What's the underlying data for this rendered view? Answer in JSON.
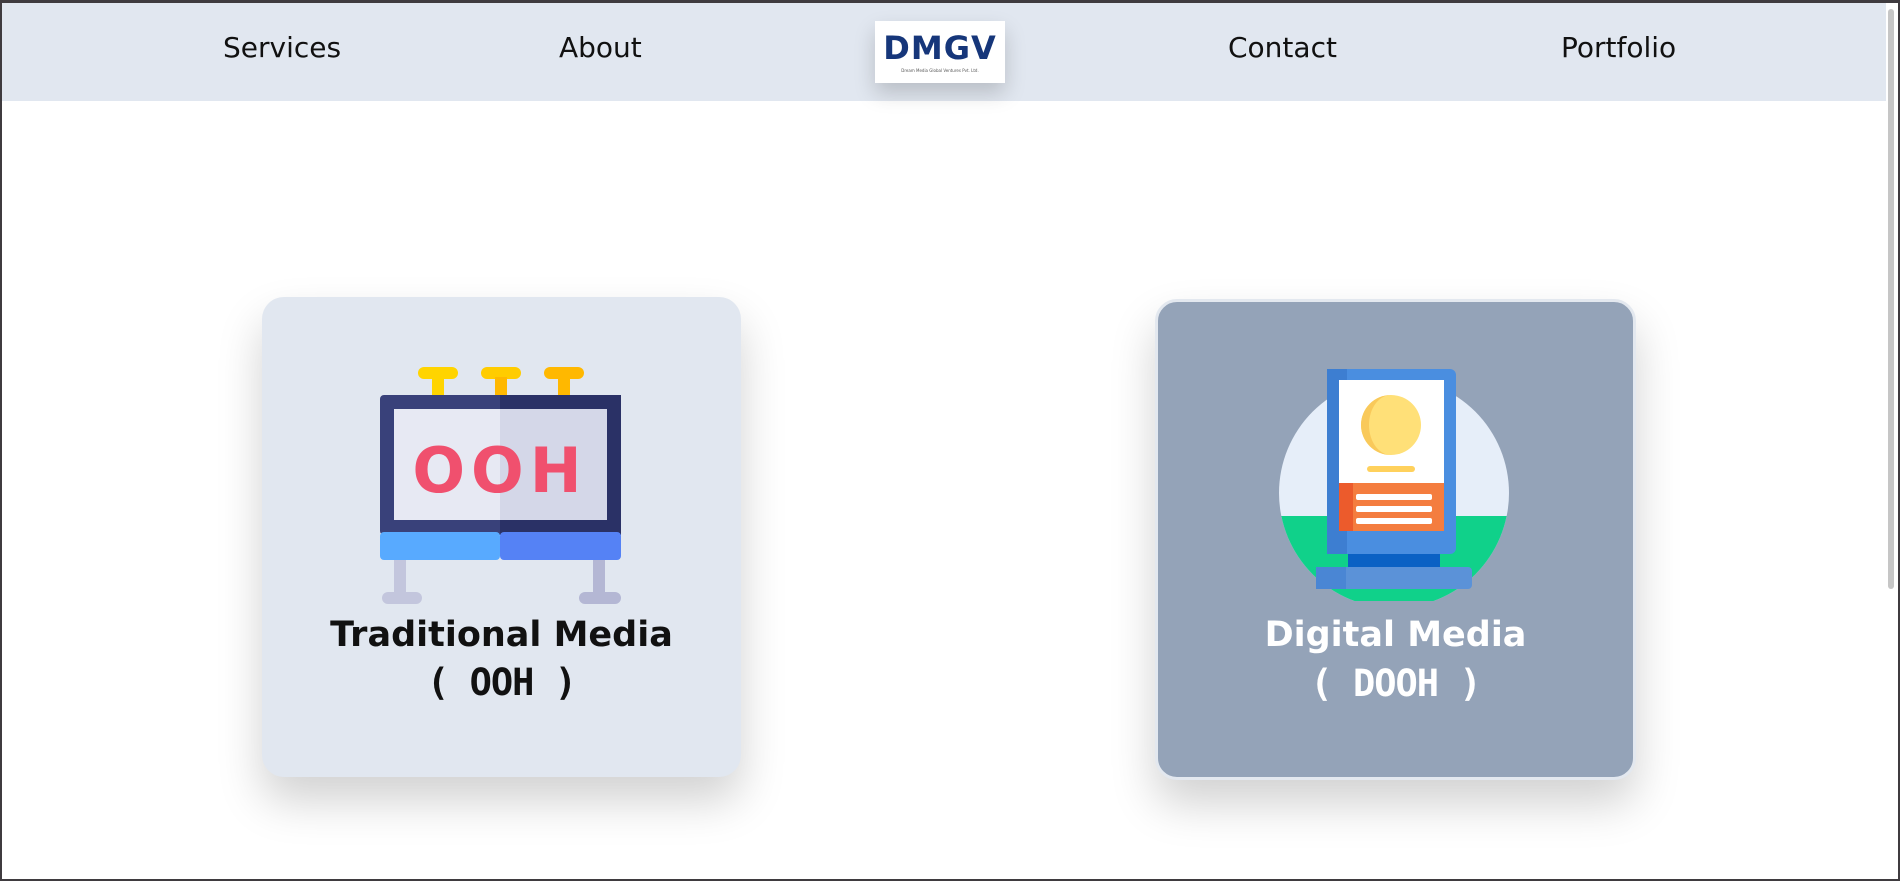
{
  "nav": {
    "items": [
      {
        "label": "Services"
      },
      {
        "label": "About"
      },
      {
        "label": "Contact"
      },
      {
        "label": "Portfolio"
      }
    ],
    "logo_text": "DMGV",
    "logo_subtitle": "Dream Media Global Ventures Pvt. Ltd."
  },
  "cards": [
    {
      "title": "Traditional Media",
      "subtitle": "( OOH )",
      "icon": "billboard-icon",
      "icon_text": "OOH",
      "text_color": "#111111",
      "bg": "#e1e7f0"
    },
    {
      "title": "Digital Media",
      "subtitle": "( DOOH )",
      "icon": "digital-kiosk-icon",
      "text_color": "#ffffff",
      "bg": "#94a3b8"
    }
  ],
  "colors": {
    "navbar_bg": "#e1e7f0",
    "logo_blue": "#16367a"
  }
}
